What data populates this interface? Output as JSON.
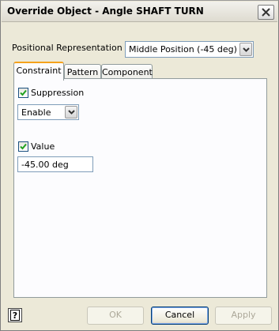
{
  "window": {
    "title": "Override Object - Angle SHAFT TURN"
  },
  "positional": {
    "label": "Positional Representation",
    "selected": "Middle Position (-45 deg)"
  },
  "tabs": [
    {
      "label": "Constraint",
      "active": true
    },
    {
      "label": "Pattern",
      "active": false
    },
    {
      "label": "Component",
      "active": false
    }
  ],
  "constraint": {
    "suppression": {
      "label": "Suppression",
      "checked": true
    },
    "suppression_select": {
      "selected": "Enable"
    },
    "value": {
      "label": "Value",
      "checked": true
    },
    "value_field": {
      "value": "-45.00 deg"
    }
  },
  "buttons": {
    "ok": "OK",
    "cancel": "Cancel",
    "apply": "Apply"
  },
  "help": {
    "glyph": "?"
  },
  "colors": {
    "accent_tab": "#f5a21c",
    "check": "#21a121",
    "field_border": "#7f9db9"
  }
}
